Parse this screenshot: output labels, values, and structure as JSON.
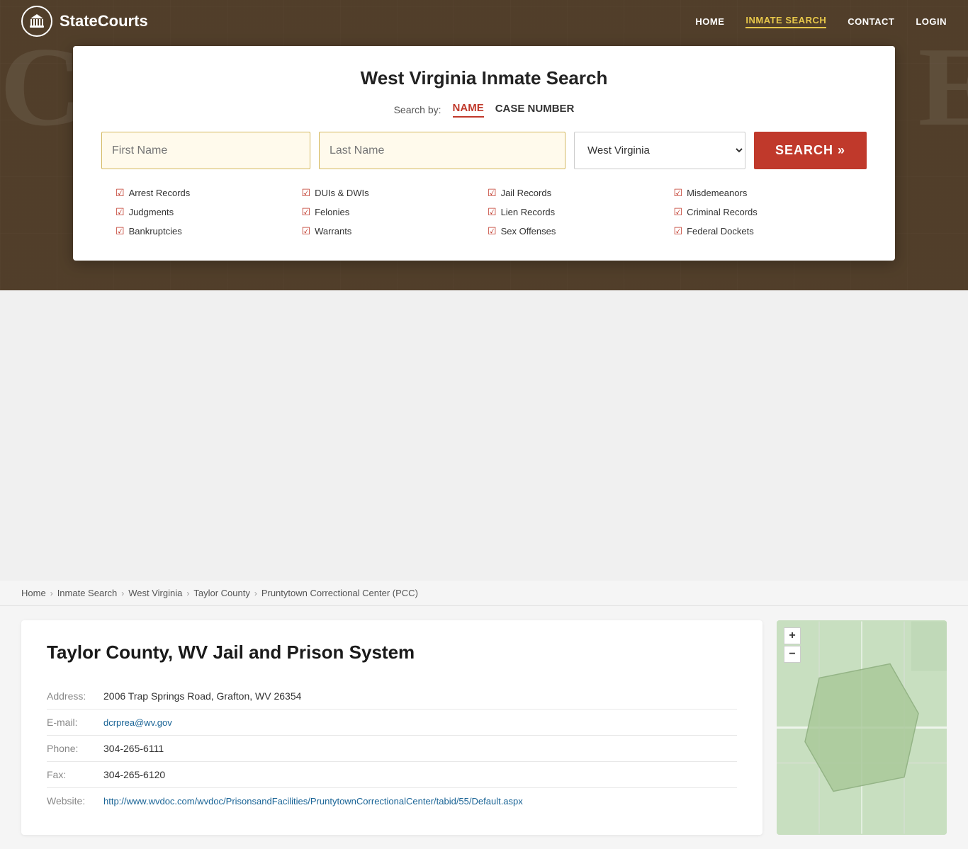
{
  "site": {
    "logo_text": "StateCourts",
    "logo_icon": "🏛"
  },
  "nav": {
    "links": [
      {
        "label": "HOME",
        "active": false
      },
      {
        "label": "INMATE SEARCH",
        "active": true
      },
      {
        "label": "CONTACT",
        "active": false
      },
      {
        "label": "LOGIN",
        "active": false
      }
    ]
  },
  "hero_letters": "COURTHOUSE",
  "modal": {
    "title": "West Virginia Inmate Search",
    "search_by_label": "Search by:",
    "tab_name": "NAME",
    "tab_case": "CASE NUMBER",
    "first_name_placeholder": "First Name",
    "last_name_placeholder": "Last Name",
    "state_default": "West Virginia",
    "search_button": "SEARCH »",
    "checkmarks": [
      "Arrest Records",
      "Judgments",
      "Bankruptcies",
      "DUIs & DWIs",
      "Felonies",
      "Warrants",
      "Jail Records",
      "Lien Records",
      "Sex Offenses",
      "Misdemeanors",
      "Criminal Records",
      "Federal Dockets"
    ]
  },
  "breadcrumb": {
    "items": [
      "Home",
      "Inmate Search",
      "West Virginia",
      "Taylor County"
    ],
    "current": "Pruntytown Correctional Center (PCC)"
  },
  "facility": {
    "title": "Taylor County, WV Jail and Prison System",
    "address_label": "Address:",
    "address_value": "2006 Trap Springs Road, Grafton, WV 26354",
    "email_label": "E-mail:",
    "email_value": "dcrprea@wv.gov",
    "phone_label": "Phone:",
    "phone_value": "304-265-6111",
    "fax_label": "Fax:",
    "fax_value": "304-265-6120",
    "website_label": "Website:",
    "website_value": "http://www.wvdoc.com/wvdoc/PrisonsandFacilities/PruntytownCorrectionalCenter/tabid/55/Default.aspx"
  },
  "map": {
    "zoom_in": "+",
    "zoom_out": "−"
  }
}
